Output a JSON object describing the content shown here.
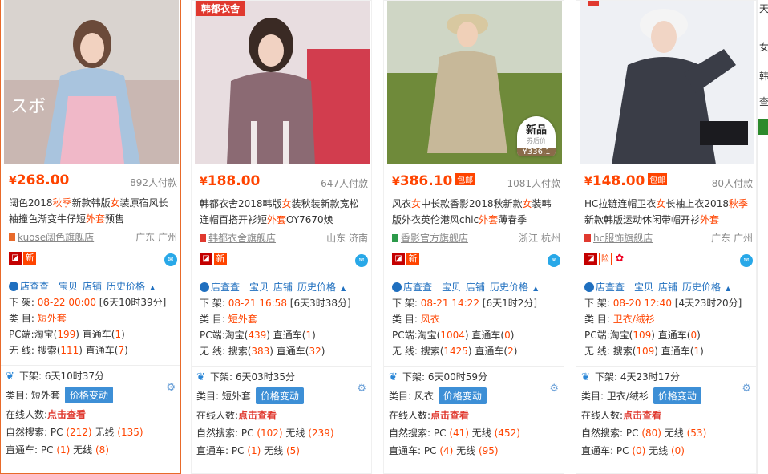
{
  "colors": {
    "price": "#ff4400",
    "link": "#1f6fbf",
    "button": "#3d8fd6",
    "selected_border": "#e86a2a"
  },
  "cards": [
    {
      "image_tag": "",
      "price": "268.00",
      "baoyou": "",
      "paid": "892人付款",
      "title_parts": [
        "阔色2018",
        "秋季",
        "新款韩版",
        "女",
        "装原宿风长袖撞色渐变牛仔短",
        "外套",
        "预售"
      ],
      "shop": "kuose阔色旗舰店",
      "location": "广东 广州",
      "badges": [
        "天猫",
        "新"
      ],
      "tools": [
        "店查查",
        "宝贝",
        "店铺",
        "历史价格"
      ],
      "off_shelf_label": "下 架:",
      "off_shelf_date": "08-22 00:00",
      "off_shelf_remain": "[6天10时39分]",
      "category_label": "类 目:",
      "category": "短外套",
      "pc_label": "PC端:",
      "pc_taobao": "淘宝(",
      "pc_taobao_n": "199",
      "pc_zhitong": ") 直通车(",
      "pc_zhitong_n": "1",
      "wx_label": "无 线:",
      "wx_search": "搜索(",
      "wx_search_n": "111",
      "wx_zhitong": ") 直通车(",
      "wx_zhitong_n": "7",
      "low_offshelf": "下架: 6天10时37分",
      "low_category_label": "类目: ",
      "low_category": "短外套",
      "price_change_btn": "价格变动",
      "online_label": "在线人数:",
      "online_link": "点击查看",
      "natural_label": "自然搜索: PC",
      "natural_pc": "(212)",
      "natural_wx_label": "无线",
      "natural_wx": "(135)",
      "ztc_label": "直通车: PC",
      "ztc_pc": "(1)",
      "ztc_wx_label": "无线",
      "ztc_wx": "(8)"
    },
    {
      "image_tag": "韩都衣舍",
      "price": "188.00",
      "baoyou": "",
      "paid": "647人付款",
      "title_parts": [
        "韩都衣舍2018韩版",
        "",
        "",
        "女",
        "装秋装新款宽松连帽百搭开衫短",
        "外套",
        "OY7670焕"
      ],
      "shop": "韩都衣舍旗舰店",
      "location": "山东 济南",
      "badges": [
        "天猫",
        "新"
      ],
      "tools": [
        "店查查",
        "宝贝",
        "店铺",
        "历史价格"
      ],
      "off_shelf_label": "下 架:",
      "off_shelf_date": "08-21 16:58",
      "off_shelf_remain": "[6天3时38分]",
      "category_label": "类 目:",
      "category": "短外套",
      "pc_label": "PC端:",
      "pc_taobao": "淘宝(",
      "pc_taobao_n": "439",
      "pc_zhitong": ") 直通车(",
      "pc_zhitong_n": "1",
      "wx_label": "无 线:",
      "wx_search": "搜索(",
      "wx_search_n": "383",
      "wx_zhitong": ") 直通车(",
      "wx_zhitong_n": "32",
      "low_offshelf": "下架: 6天03时35分",
      "low_category_label": "类目: ",
      "low_category": "短外套",
      "price_change_btn": "价格变动",
      "online_label": "在线人数:",
      "online_link": "点击查看",
      "natural_label": "自然搜索: PC",
      "natural_pc": "(102)",
      "natural_wx_label": "无线",
      "natural_wx": "(239)",
      "ztc_label": "直通车: PC",
      "ztc_pc": "(1)",
      "ztc_wx_label": "无线",
      "ztc_wx": "(5)"
    },
    {
      "image_tag": "",
      "price": "386.10",
      "baoyou": "包邮",
      "paid": "1081人付款",
      "title_parts": [
        "风衣",
        "",
        "",
        "女",
        "中长款香影2018秋新款",
        "女",
        "装韩版外衣英伦港风chic",
        "外套",
        "薄春季"
      ],
      "shop": "香影官方旗舰店",
      "location": "浙江 杭州",
      "badges": [
        "天猫",
        "新"
      ],
      "tools": [
        "店查查",
        "宝贝",
        "店铺",
        "历史价格"
      ],
      "sticker": {
        "line1": "新品",
        "line2": "券后价",
        "line3": "¥336.1"
      },
      "off_shelf_label": "下 架:",
      "off_shelf_date": "08-21 14:22",
      "off_shelf_remain": "[6天1时2分]",
      "category_label": "类 目:",
      "category": "风衣",
      "pc_label": "PC端:",
      "pc_taobao": "淘宝(",
      "pc_taobao_n": "1004",
      "pc_zhitong": ") 直通车(",
      "pc_zhitong_n": "0",
      "wx_label": "无 线:",
      "wx_search": "搜索(",
      "wx_search_n": "1425",
      "wx_zhitong": ") 直通车(",
      "wx_zhitong_n": "2",
      "low_offshelf": "下架: 6天00时59分",
      "low_category_label": "类目: ",
      "low_category": "风衣",
      "price_change_btn": "价格变动",
      "online_label": "在线人数:",
      "online_link": "点击查看",
      "natural_label": "自然搜索: PC",
      "natural_pc": "(41)",
      "natural_wx_label": "无线",
      "natural_wx": "(452)",
      "ztc_label": "直通车: PC",
      "ztc_pc": "(4)",
      "ztc_wx_label": "无线",
      "ztc_wx": "(95)"
    },
    {
      "image_tag": "",
      "price": "148.00",
      "baoyou": "包邮",
      "paid": "80人付款",
      "title_parts": [
        "HC拉链连帽卫衣",
        "",
        "",
        "女",
        "长袖上衣2018",
        "秋季",
        "新款韩版运动休闲带帽开衫",
        "外套",
        ""
      ],
      "shop": "hc服饰旗舰店",
      "location": "广东 广州",
      "badges": [
        "天猫",
        "险",
        "花"
      ],
      "tools": [
        "店查查",
        "宝贝",
        "店铺",
        "历史价格"
      ],
      "off_shelf_label": "下 架:",
      "off_shelf_date": "08-20 12:40",
      "off_shelf_remain": "[4天23时20分]",
      "category_label": "类 目:",
      "category": "卫衣/绒衫",
      "pc_label": "PC端:",
      "pc_taobao": "淘宝(",
      "pc_taobao_n": "109",
      "pc_zhitong": ") 直通车(",
      "pc_zhitong_n": "0",
      "wx_label": "无 线:",
      "wx_search": "搜索(",
      "wx_search_n": "109",
      "wx_zhitong": ") 直通车(",
      "wx_zhitong_n": "1",
      "low_offshelf": "下架: 4天23时17分",
      "low_category_label": "类目: ",
      "low_category": "卫衣/绒衫",
      "price_change_btn": "价格变动",
      "online_label": "在线人数:",
      "online_link": "点击查看",
      "natural_label": "自然搜索: PC",
      "natural_pc": "(80)",
      "natural_wx_label": "无线",
      "natural_wx": "(53)",
      "ztc_label": "直通车: PC",
      "ztc_pc": "(0)",
      "ztc_wx_label": "无线",
      "ztc_wx": "(0)"
    }
  ],
  "right_strip": [
    "天",
    "女",
    "韩",
    "查"
  ]
}
